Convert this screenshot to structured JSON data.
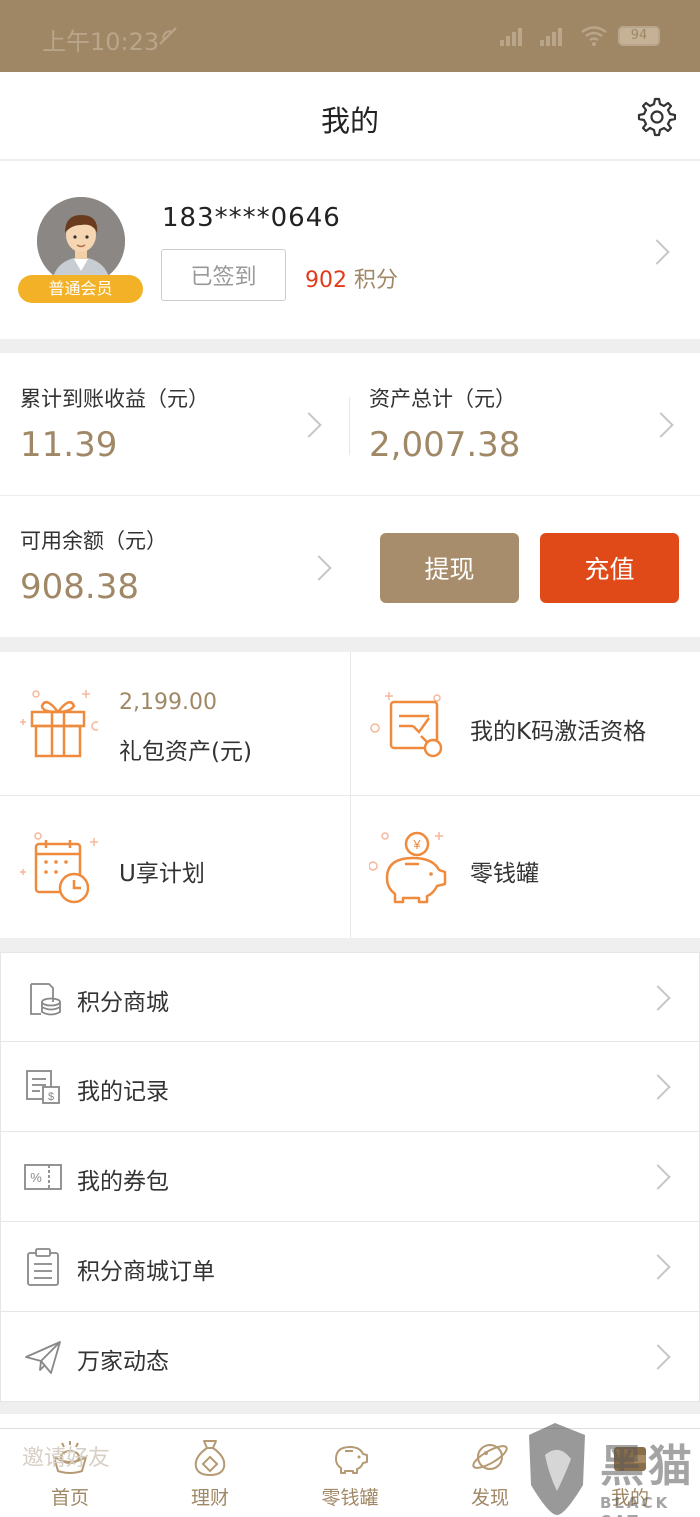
{
  "status_bar": {
    "time": "上午10:23",
    "battery": "94"
  },
  "header": {
    "title": "我的"
  },
  "profile": {
    "phone": "183****0646",
    "member_level": "普通会员",
    "signin_label": "已签到",
    "points_value": "902",
    "points_unit": "积分"
  },
  "assets": {
    "cumulative_label": "累计到账收益（元）",
    "cumulative_value": "11.39",
    "total_label": "资产总计（元）",
    "total_value": "2,007.38",
    "balance_label": "可用余额（元）",
    "balance_value": "908.38",
    "withdraw_label": "提现",
    "recharge_label": "充值"
  },
  "grid": {
    "gift_amount": "2,199.00",
    "gift_label": "礼包资产(元)",
    "kcode_label": "我的K码激活资格",
    "plan_label": "U享计划",
    "piggy_label": "零钱罐"
  },
  "menu": [
    {
      "label": "积分商城",
      "icon": "coins-icon"
    },
    {
      "label": "我的记录",
      "icon": "records-icon"
    },
    {
      "label": "我的券包",
      "icon": "coupon-icon"
    },
    {
      "label": "积分商城订单",
      "icon": "clipboard-icon"
    },
    {
      "label": "万家动态",
      "icon": "paper-plane-icon"
    }
  ],
  "ghost_row": {
    "label": "邀请好友"
  },
  "tabbar": {
    "home": "首页",
    "finance": "理财",
    "piggy": "零钱罐",
    "discover": "发现",
    "mine": "我的"
  },
  "watermark": {
    "text": "黑猫",
    "sub": "BLACK CAT"
  },
  "colors": {
    "brand_brown": "#a08866",
    "status_bar": "#9f8766",
    "accent_red": "#e04a18",
    "icon_orange": "#f08a3c",
    "badge_yellow": "#f2b126"
  }
}
